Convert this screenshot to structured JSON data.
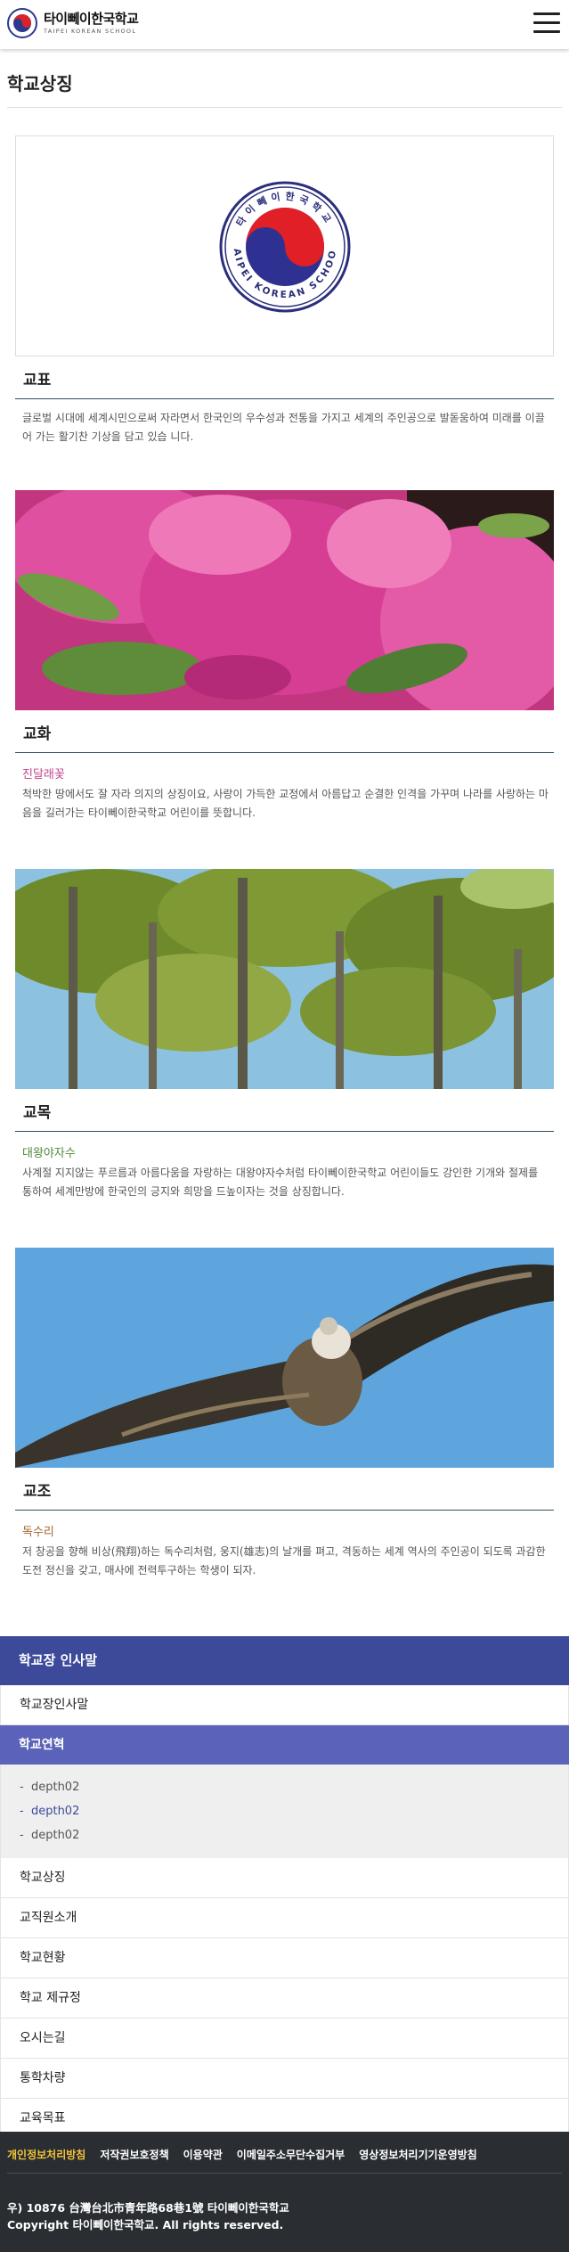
{
  "header": {
    "logo_ko": "타이뻬이한국학교",
    "logo_en": "TAIPEI KOREAN SCHOOL"
  },
  "page": {
    "title": "학교상징"
  },
  "emblem": {
    "ring_top_text": "타이뻬이한국학교",
    "ring_bottom_text": "TAIPEI KOREAN SCHOOL"
  },
  "sections": [
    {
      "heading": "교표",
      "sub_name": "",
      "desc": "글로벌 시대에 세계시민으로써 자라면서 한국인의 우수성과 전통을 가지고 세계의 주인공으로 발돋움하여 미래를 이끌어 가는 활기찬 기상을 담고 있습 니다."
    },
    {
      "heading": "교화",
      "sub_name": "진달래꽃",
      "sub_color": "#c2448a",
      "desc": "척박한 땅에서도 잘 자라 의지의 상징이요, 사랑이 가득한 교정에서 아름답고 순결한 인격을 가꾸며 나라를 사랑하는 마음을 길러가는 타이뻬이한국학교 어린이를 뜻합니다."
    },
    {
      "heading": "교목",
      "sub_name": "대왕야자수",
      "sub_color": "#4f8a3a",
      "desc": "사계절 지지않는 푸르름과 아름다움을 자랑하는 대왕야자수처럼 타이뻬이한국학교 어린이들도 강인한 기개와 절제를 통하여 세계만방에 한국인의 긍지와 희망을 드높이자는 것을 상징합니다."
    },
    {
      "heading": "교조",
      "sub_name": "독수리",
      "sub_color": "#a5662b",
      "desc": "저 창공을 향해 비상(飛翔)하는 독수리처럼, 웅지(雄志)의 날개를 펴고, 격동하는 세계 역사의 주인공이 되도록 과감한 도전 정신을 갖고, 매사에 전력투구하는 학생이 되자."
    }
  ],
  "side_nav": {
    "head": "학교장 인사말",
    "items_before": [
      "학교장인사말"
    ],
    "active": "학교연혁",
    "sub_items": [
      "depth02",
      "depth02",
      "depth02"
    ],
    "items_after": [
      "학교상징",
      "교직원소개",
      "학교현황",
      "학교 제규정",
      "오시는길",
      "통학차량",
      "교육목표"
    ]
  },
  "footer": {
    "links": [
      "개인정보처리방침",
      "저작권보호정책",
      "이용약관",
      "이메일주소무단수집거부",
      "영상정보처리기기운영방침"
    ],
    "address": "우) 10876 台灣台北市青年路68巷1號 타이뻬이한국학교",
    "copyright": "Copyright 타이뻬이한국학교. All rights reserved."
  },
  "colors": {
    "nav_head": "#3d4a9a",
    "nav_active": "#5a63b9",
    "footer_bg": "#2a2e33",
    "footer_highlight": "#f2c23a"
  }
}
